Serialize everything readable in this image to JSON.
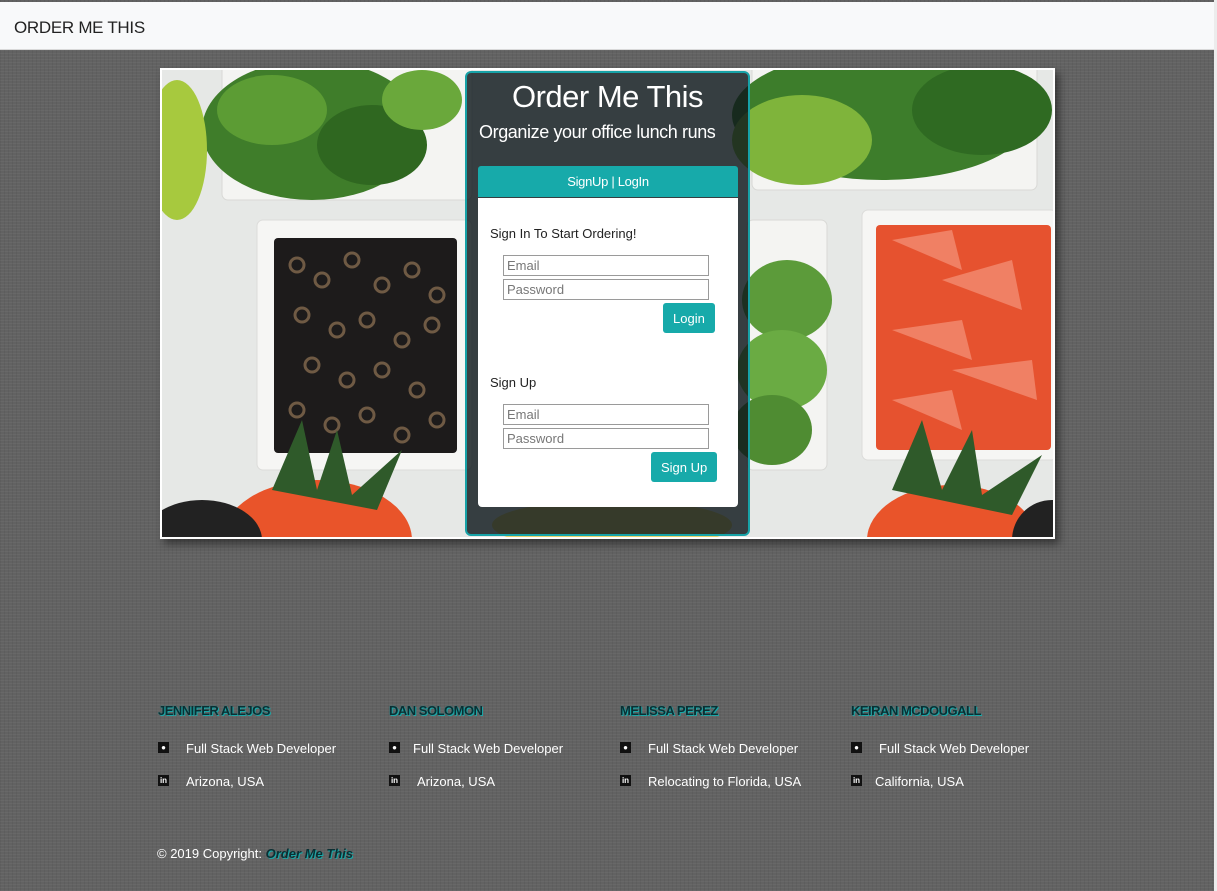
{
  "navbar": {
    "brand": "ORDER ME THIS"
  },
  "hero": {
    "title": "Order Me This",
    "subtitle": "Organize your office lunch runs",
    "tab_label": "SignUp | LogIn",
    "login": {
      "heading": "Sign In To Start Ordering!",
      "email_placeholder": "Email",
      "password_placeholder": "Password",
      "button": "Login"
    },
    "signup": {
      "heading": "Sign Up",
      "email_placeholder": "Email",
      "password_placeholder": "Password",
      "button": "Sign Up"
    }
  },
  "team": [
    {
      "name": "JENNIFER ALEJOS",
      "role": "Full Stack Web Developer",
      "location": "Arizona, USA"
    },
    {
      "name": "DAN SOLOMON",
      "role": "Full Stack Web Developer",
      "location": "Arizona, USA"
    },
    {
      "name": "MELISSA PEREZ",
      "role": "Full Stack Web Developer",
      "location": "Relocating to Florida, USA"
    },
    {
      "name": "KEIRAN MCDOUGALL",
      "role": "Full Stack Web Developer",
      "location": "California, USA"
    }
  ],
  "footer": {
    "copyright_prefix": "© 2019 Copyright:",
    "copyright_link": "Order Me This"
  },
  "icons": {
    "role": "github-icon",
    "location": "linkedin-icon"
  },
  "colors": {
    "accent": "#17aaaa",
    "navbar_bg": "#f8f9fa",
    "page_bg": "#626262"
  }
}
